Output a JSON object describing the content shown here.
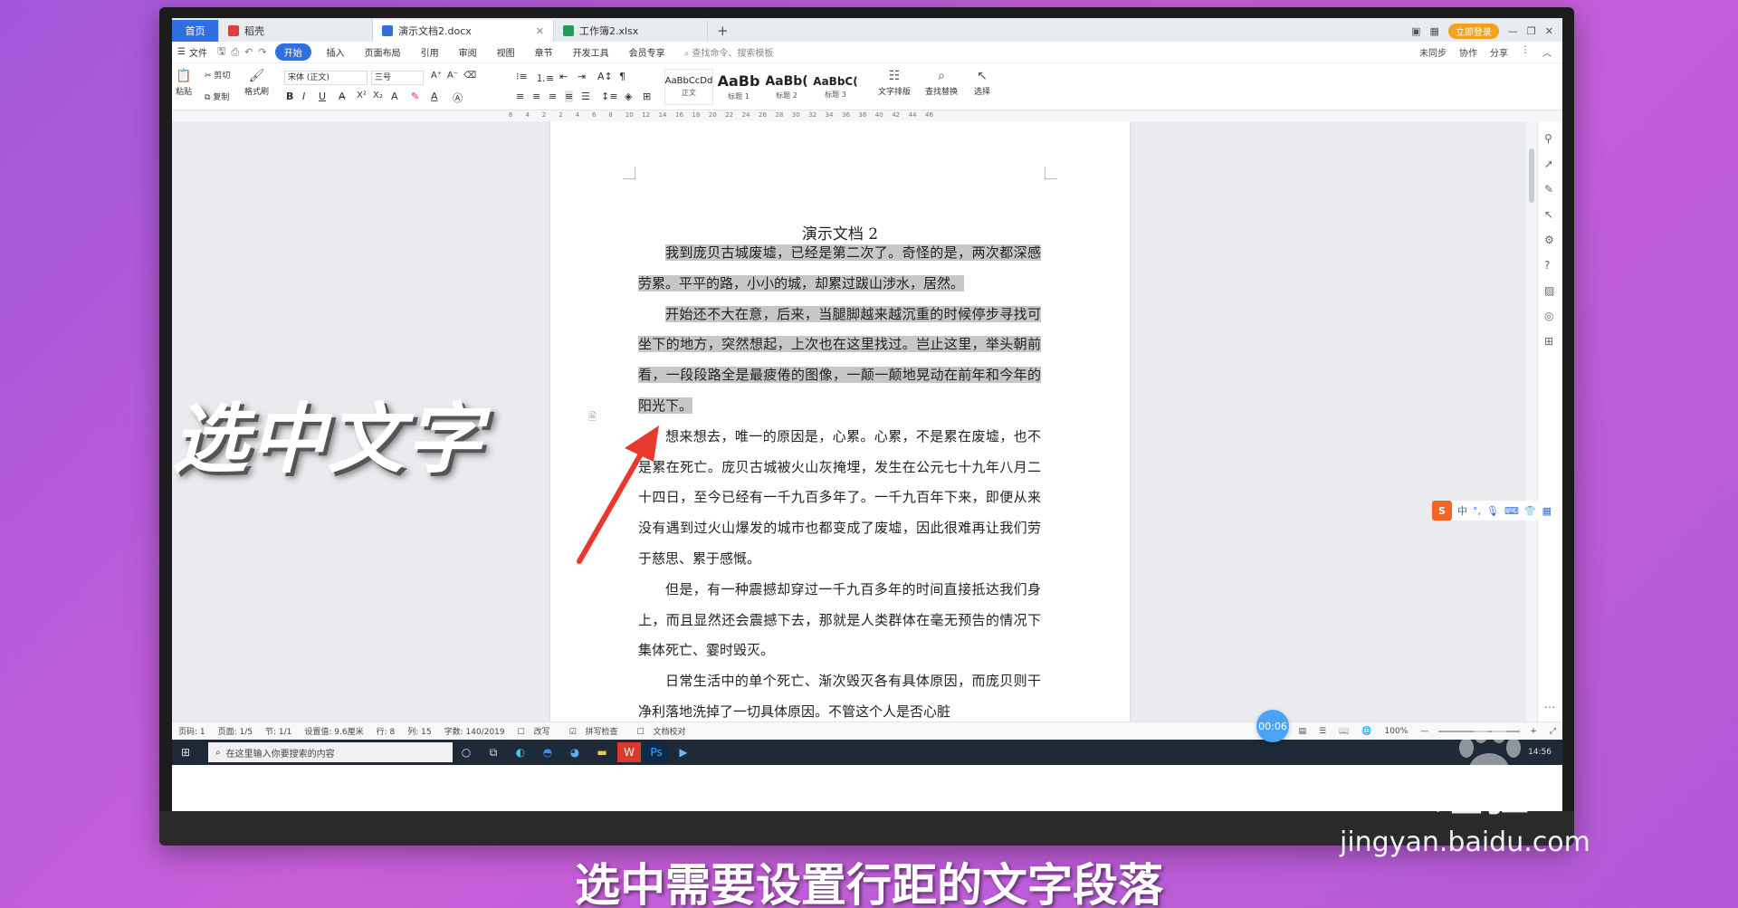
{
  "tabs": {
    "home": "首页",
    "items": [
      {
        "label": "稻壳",
        "icon_color": "#e23b3b"
      },
      {
        "label": "演示文档2.docx",
        "icon_color": "#2f6fe0"
      },
      {
        "label": "工作簿2.xlsx",
        "icon_color": "#1f9d55"
      }
    ],
    "new_tab": "+",
    "login": "立即登录"
  },
  "menu": {
    "file": "文件",
    "items": [
      "开始",
      "插入",
      "页面布局",
      "引用",
      "审阅",
      "视图",
      "章节",
      "开发工具",
      "会员专享"
    ],
    "active": "开始",
    "search_cmd": "查找命令、搜索模板",
    "right": [
      "未同步",
      "协作",
      "分享"
    ]
  },
  "ribbon": {
    "paste": "粘贴",
    "cut": "剪切",
    "copy": "复制",
    "format_painter": "格式刷",
    "font_name": "宋体 (正文)",
    "font_size": "三号",
    "styles": [
      {
        "preview": "AaBbCcDd",
        "name": "正文"
      },
      {
        "preview": "AaBb",
        "name": "标题 1"
      },
      {
        "preview": "AaBb(",
        "name": "标题 2"
      },
      {
        "preview": "AaBbC(",
        "name": "标题 3"
      }
    ],
    "text_layout": "文字排版",
    "find_replace": "查找替换",
    "select": "选择"
  },
  "ruler": [
    "6",
    "4",
    "2",
    "2",
    "4",
    "6",
    "8",
    "10",
    "12",
    "14",
    "16",
    "18",
    "20",
    "22",
    "24",
    "26",
    "28",
    "30",
    "32",
    "34",
    "36",
    "38",
    "40",
    "42",
    "44",
    "46"
  ],
  "document": {
    "title": "演示文档 2",
    "selected_paragraphs": [
      "我到庞贝古城废墟，已经是第二次了。奇怪的是，两次都深感劳累。平平的路，小小的城，却累过跋山涉水，居然。",
      "开始还不大在意，后来，当腿脚越来越沉重的时候停步寻找可坐下的地方，突然想起，上次也在这里找过。岂止这里，举头朝前看，一段段路全是最疲倦的图像，一颠一颠地晃动在前年和今年的阳光下。"
    ],
    "paragraphs": [
      "想来想去，唯一的原因是，心累。心累，不是累在废墟，也不是累在死亡。庞贝古城被火山灰掩埋，发生在公元七十九年八月二十四日，至今已经有一千九百多年了。一千九百年下来，即便从来没有遇到过火山爆发的城市也都变成了废墟，因此很难再让我们劳于慈思、累于感慨。",
      "但是，有一种震撼却穿过一千九百多年的时间直接抵达我们身上，而且显然还会震撼下去，那就是人类群体在毫无预告的情况下集体死亡、霎时毁灭。",
      "日常生活中的单个死亡、渐次毁灭各有具体原因，而庞贝则干净利落地洗掉了一切具体原因。不管这个人是否心脏"
    ]
  },
  "status": {
    "items": [
      "页码: 1",
      "页面: 1/5",
      "节: 1/1",
      "设置值: 9.6厘米",
      "行: 8",
      "列: 15",
      "字数: 140/2019",
      "改写",
      "拼写检查",
      "文档校对"
    ],
    "zoom": "100%"
  },
  "taskbar": {
    "search_placeholder": "在这里输入你要搜索的内容",
    "time": "14:56"
  },
  "ime": {
    "items": [
      "中",
      "°,"
    ]
  },
  "timer": "00:06",
  "overlay": {
    "title": "选中文字",
    "subtitle": "选中需要设置行距的文字段落"
  },
  "watermark": {
    "brand_left": "Bai",
    "brand_cn": "经验",
    "url": "jingyan.baidu.com"
  },
  "colors": {
    "accent": "#2f6fe0",
    "selection": "#c7c7c7",
    "arrow": "#e8392f",
    "background": "#b25ad6"
  }
}
